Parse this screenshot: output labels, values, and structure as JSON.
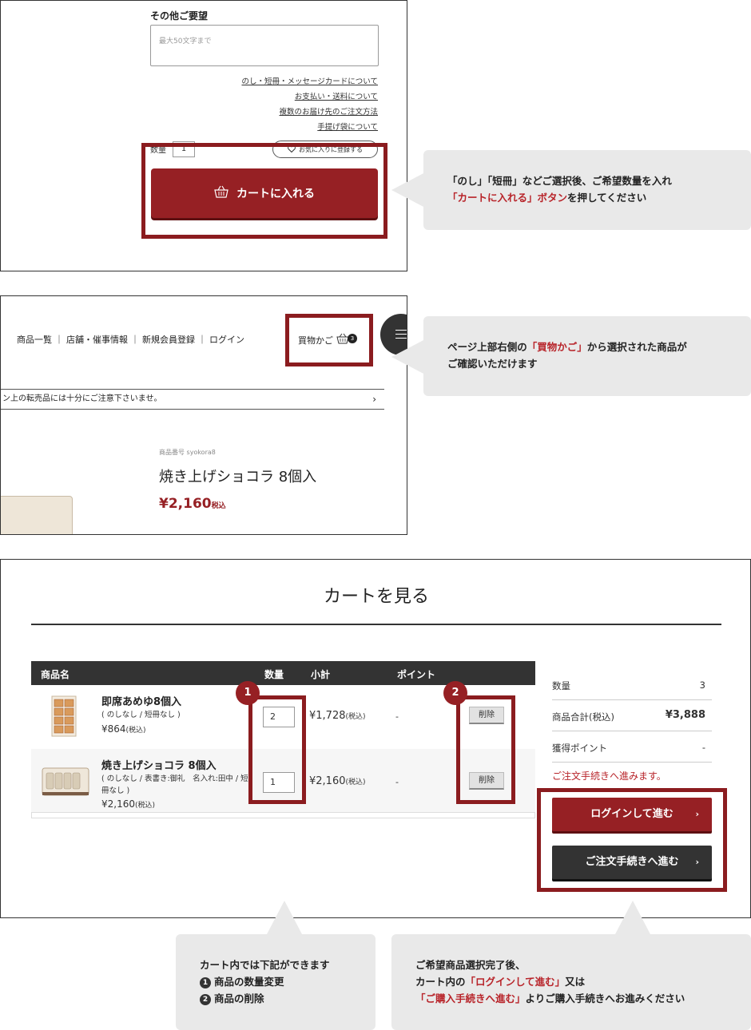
{
  "panel1": {
    "request_title": "その他ご要望",
    "request_placeholder": "最大50文字まで",
    "links": [
      "のし・短冊・メッセージカードについて",
      "お支払い・送料について",
      "複数のお届け先のご注文方法",
      "手提げ袋について"
    ],
    "qty_label": "数量",
    "qty_value": "1",
    "favorite_label": "お気に入りに登録する",
    "cart_button_label": "カートに入れる"
  },
  "callout1": {
    "line1": "「のし」「短冊」などご選択後、ご希望数量を入れ",
    "line2_red": "「カートに入れる」ボタン",
    "line2_rest": "を押してください"
  },
  "panel2": {
    "nav": "商品一覧 ｜ 店舗・催事情報 ｜ 新規会員登録 ｜ ログイン",
    "cart_label": "買物かご",
    "cart_badge": "3",
    "notice": "ン上の転売品には十分にご注意下さいませ。",
    "product_code": "商品番号 syokora8",
    "product_name": "焼き上げショコラ 8個入",
    "price": "¥2,160",
    "price_tax": "税込"
  },
  "callout2": {
    "line1_pre": "ページ上部右側の",
    "line1_red": "「買物かご」",
    "line1_post": "から選択された商品が",
    "line2": "ご確認いただけます"
  },
  "panel3": {
    "title": "カートを見る",
    "headers": {
      "name": "商品名",
      "qty": "数量",
      "subtotal": "小計",
      "point": "ポイント"
    },
    "items": [
      {
        "name": "即席あめゆ8個入",
        "options": "( のしなし / 短冊なし )",
        "price": "¥864",
        "tax": "(税込)",
        "qty": "2",
        "subtotal": "¥1,728",
        "subtotal_tax": "(税込)",
        "point": "-",
        "delete": "削除"
      },
      {
        "name": "焼き上げショコラ 8個入",
        "options": "( のしなし / 表書き:御礼　名入れ:田中 / 短冊なし )",
        "price": "¥2,160",
        "tax": "(税込)",
        "qty": "1",
        "subtotal": "¥2,160",
        "subtotal_tax": "(税込)",
        "point": "-",
        "delete": "削除"
      }
    ],
    "markers": [
      "1",
      "2"
    ],
    "summary": {
      "qty_label": "数量",
      "qty_value": "3",
      "total_label": "商品合計(税込)",
      "total_value": "¥3,888",
      "points_label": "獲得ポイント",
      "points_value": "-"
    },
    "proceed_text": "ご注文手続きへ進みます。",
    "login_button": "ログインして進む",
    "order_button": "ご注文手続きへ進む",
    "chevron": "›"
  },
  "callout3": {
    "line1": "カート内では下記ができます",
    "item1_num": "1",
    "item1": "商品の数量変更",
    "item2_num": "2",
    "item2": "商品の削除"
  },
  "callout4": {
    "line1": "ご希望商品選択完了後、",
    "line2_pre": "カート内の",
    "line2_red": "「ログインして進む」",
    "line2_post": "又は",
    "line3_red": "「ご購入手続きへ進む」",
    "line3_post": "よりご購入手続きへお進みください"
  },
  "colors": {
    "accent": "#962024",
    "highlight_border": "#8b1c1f",
    "bubble_bg": "#e9e9e9",
    "dark_button": "#333333"
  }
}
